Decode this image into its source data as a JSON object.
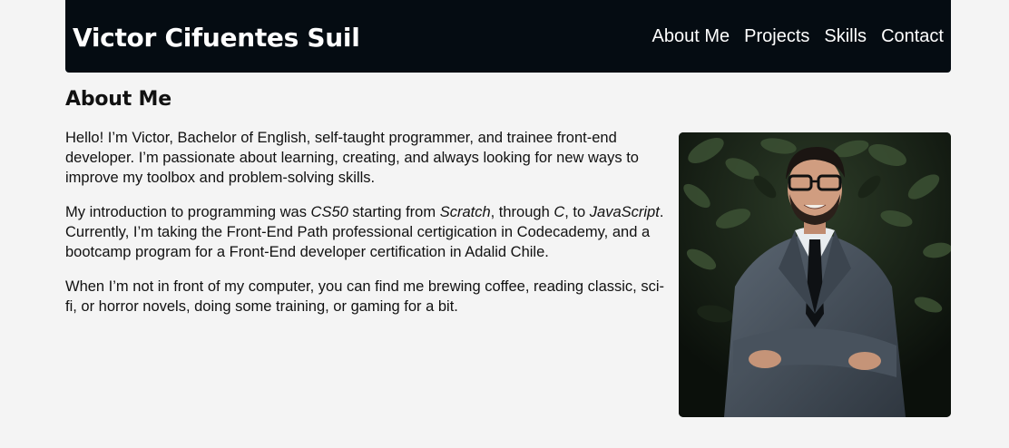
{
  "header": {
    "site_title": "Victor Cifuentes Suil",
    "nav": [
      {
        "label": "About Me"
      },
      {
        "label": "Projects"
      },
      {
        "label": "Skills"
      },
      {
        "label": "Contact"
      }
    ]
  },
  "about": {
    "title": "About Me",
    "p1": "Hello! I’m Victor, Bachelor of English, self-taught programmer, and trainee front-end developer. I’m passionate about learning, creating, and always looking for new ways to improve my toolbox and problem-solving skills.",
    "p2": {
      "t1": "My introduction to programming was ",
      "i1": "CS50",
      "t2": " starting from ",
      "i2": "Scratch",
      "t3": ", through ",
      "i3": "C",
      "t4": ", to ",
      "i4": "JavaScript",
      "t5": ". Currently, I’m taking the Front-End Path professional certigication in Codecademy, and a bootcamp program for a Front-End developer certification in Adalid Chile."
    },
    "p3": "When I’m not in front of my computer, you can find me brewing coffee, reading classic, sci-fi, or horror novels, doing some training, or gaming for a bit."
  },
  "colors": {
    "header_bg": "#050c12",
    "page_bg": "#f4f4f4"
  }
}
